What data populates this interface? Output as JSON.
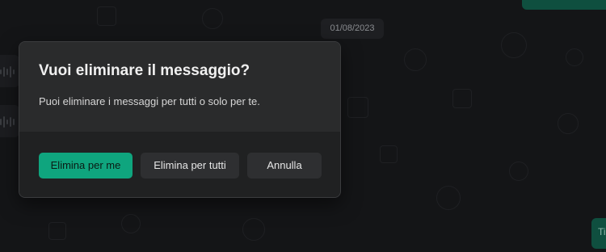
{
  "chat": {
    "date_chip": "01/08/2023",
    "partial_message_text": "Ti"
  },
  "dialog": {
    "title": "Vuoi eliminare il messaggio?",
    "message": "Puoi eliminare i messaggi per tutti o solo per te.",
    "buttons": {
      "delete_for_me": "Elimina per me",
      "delete_for_all": "Elimina per tutti",
      "cancel": "Annulla"
    }
  },
  "colors": {
    "accent": "#0fa57e",
    "dialog_background": "#2a2b2c",
    "chat_background": "#141517"
  }
}
